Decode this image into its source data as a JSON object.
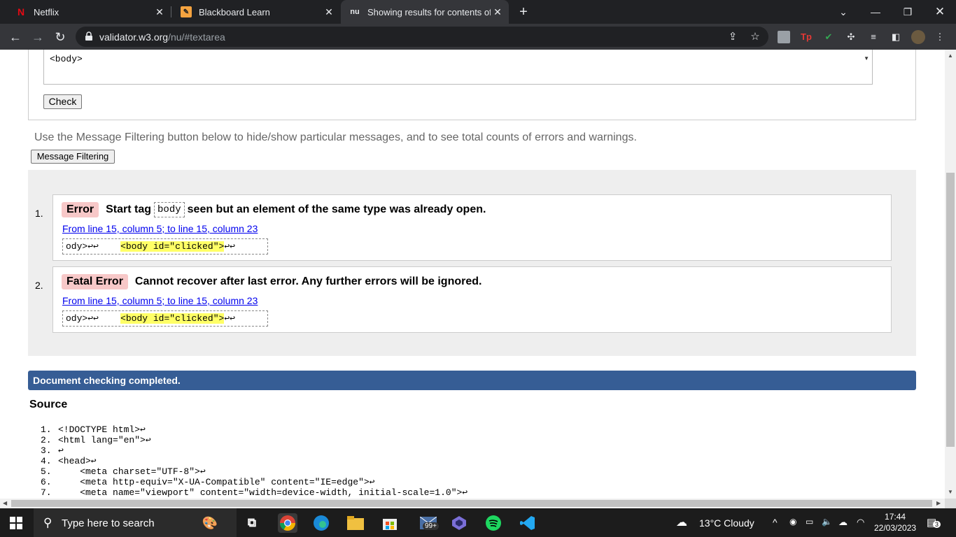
{
  "browser": {
    "tabs": [
      {
        "label": "Netflix",
        "favicon": "N",
        "active": false
      },
      {
        "label": "Blackboard Learn",
        "favicon": "bb",
        "active": false
      },
      {
        "label": "Showing results for contents of t",
        "favicon": "nu",
        "active": true
      }
    ],
    "url_host": "validator.w3.org",
    "url_path": "/nu/#textarea"
  },
  "textarea": {
    "content": "<body>\n\n    <body id=\"clicked\">"
  },
  "check_label": "Check",
  "filter_hint": "Use the Message Filtering button below to hide/show particular messages, and to see total counts of errors and warnings.",
  "filter_label": "Message Filtering",
  "messages": [
    {
      "num": "1.",
      "type": "Error",
      "text_before": "Start tag",
      "code": "body",
      "text_after": "seen but an element of the same type was already open.",
      "location": "From line 15, column 5; to line 15, column 23",
      "extract_pre": "ody>↩↩    ",
      "extract_hl": "<body id=\"clicked\">",
      "extract_post": "↩↩"
    },
    {
      "num": "2.",
      "type": "Fatal Error",
      "text": "Cannot recover after last error. Any further errors will be ignored.",
      "location": "From line 15, column 5; to line 15, column 23",
      "extract_pre": "ody>↩↩    ",
      "extract_hl": "<body id=\"clicked\">",
      "extract_post": "↩↩"
    }
  ],
  "done_text": "Document checking completed.",
  "source_heading": "Source",
  "source_lines": [
    {
      "num": "1.",
      "code": "<!DOCTYPE html>↩"
    },
    {
      "num": "2.",
      "code": "<html lang=\"en\">↩"
    },
    {
      "num": "3.",
      "code": "↩"
    },
    {
      "num": "4.",
      "code": "<head>↩"
    },
    {
      "num": "5.",
      "code": "    <meta charset=\"UTF-8\">↩"
    },
    {
      "num": "6.",
      "code": "    <meta http-equiv=\"X-UA-Compatible\" content=\"IE=edge\">↩"
    },
    {
      "num": "7.",
      "code": "    <meta name=\"viewport\" content=\"width=device-width, initial-scale=1.0\">↩"
    }
  ],
  "taskbar": {
    "search_placeholder": "Type here to search",
    "mail_badge": "99+",
    "weather": "13°C  Cloudy",
    "time": "17:44",
    "date": "22/03/2023",
    "notif_count": "3"
  },
  "colors": {
    "error_badge": "#f7c8c8",
    "done_bar": "#365d95",
    "highlight": "#ffff66"
  }
}
